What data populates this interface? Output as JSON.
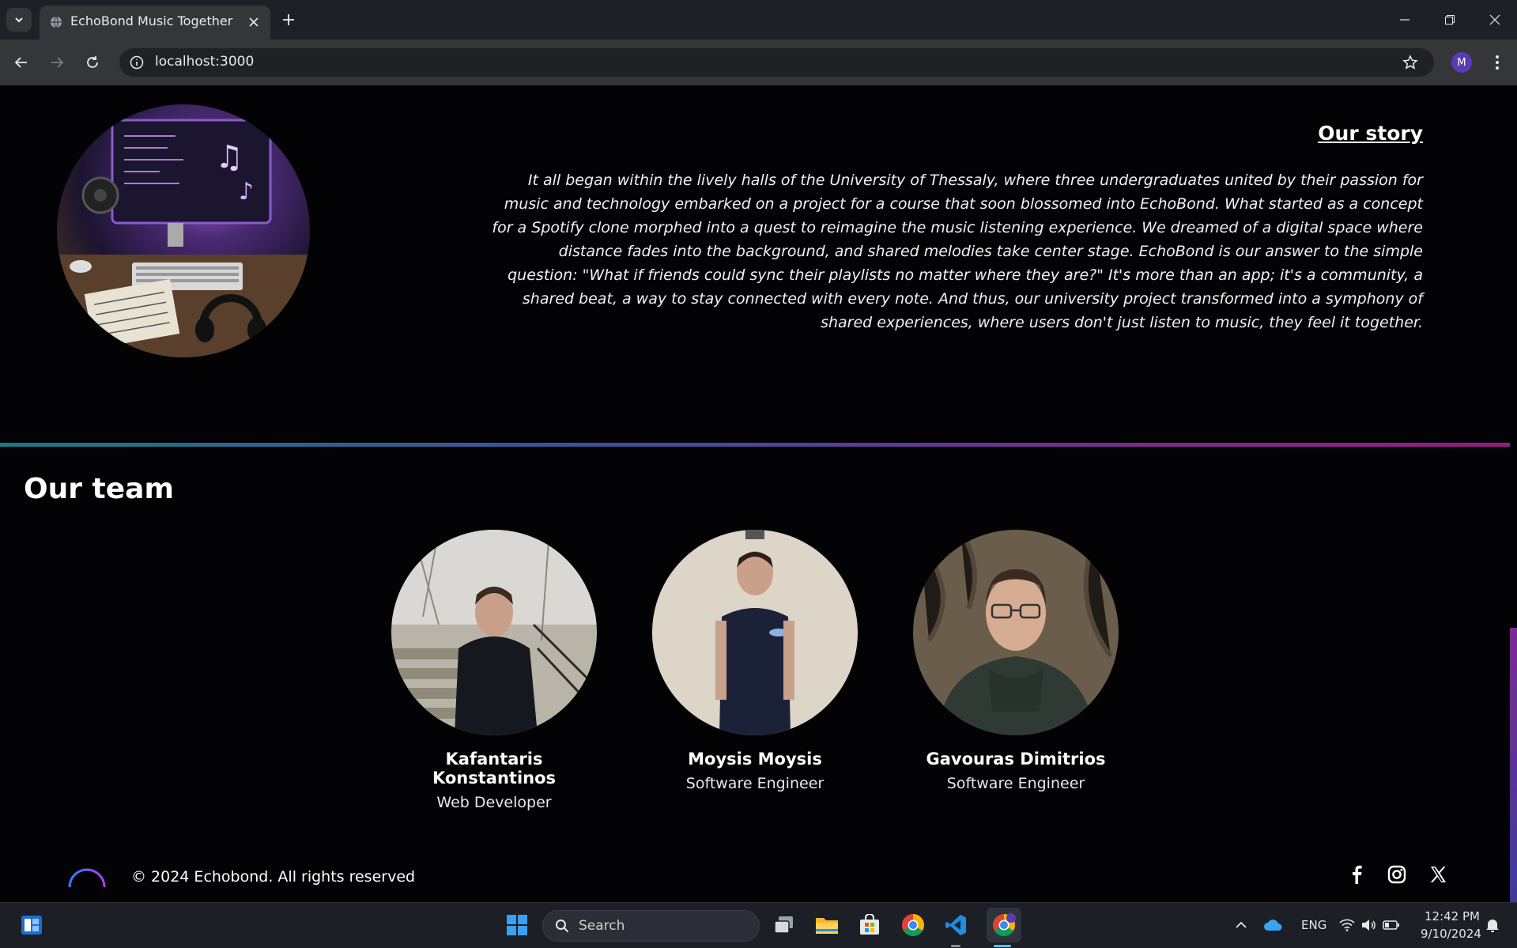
{
  "browser": {
    "tab_title": "EchoBond Music Together",
    "url": "localhost:3000",
    "profile_initial": "M"
  },
  "story": {
    "title": "Our story",
    "text": "It all began within the lively halls of the University of Thessaly, where three undergraduates united by their passion for music and technology embarked on a project for a course that soon blossomed into EchoBond. What started as a concept for a Spotify clone morphed into a quest to reimagine the music listening experience. We dreamed of a digital space where distance fades into the background, and shared melodies take center stage. EchoBond is our answer to the simple question: \"What if friends could sync their playlists no matter where they are?\" It's more than an app; it's a community, a shared beat, a way to stay connected with every note. And thus, our university project transformed into a symphony of shared experiences, where users don't just listen to music, they feel it together."
  },
  "team": {
    "title": "Our team",
    "members": [
      {
        "name": "Kafantaris Konstantinos",
        "role": "Web Developer"
      },
      {
        "name": "Moysis Moysis",
        "role": "Software Engineer"
      },
      {
        "name": "Gavouras Dimitrios",
        "role": "Software Engineer"
      }
    ]
  },
  "footer": {
    "copyright": "© 2024 Echobond. All rights reserved",
    "social": [
      "facebook-icon",
      "instagram-icon",
      "x-icon"
    ]
  },
  "taskbar": {
    "search_label": "Search",
    "language": "ENG",
    "time": "12:42 PM",
    "date": "9/10/2024"
  }
}
